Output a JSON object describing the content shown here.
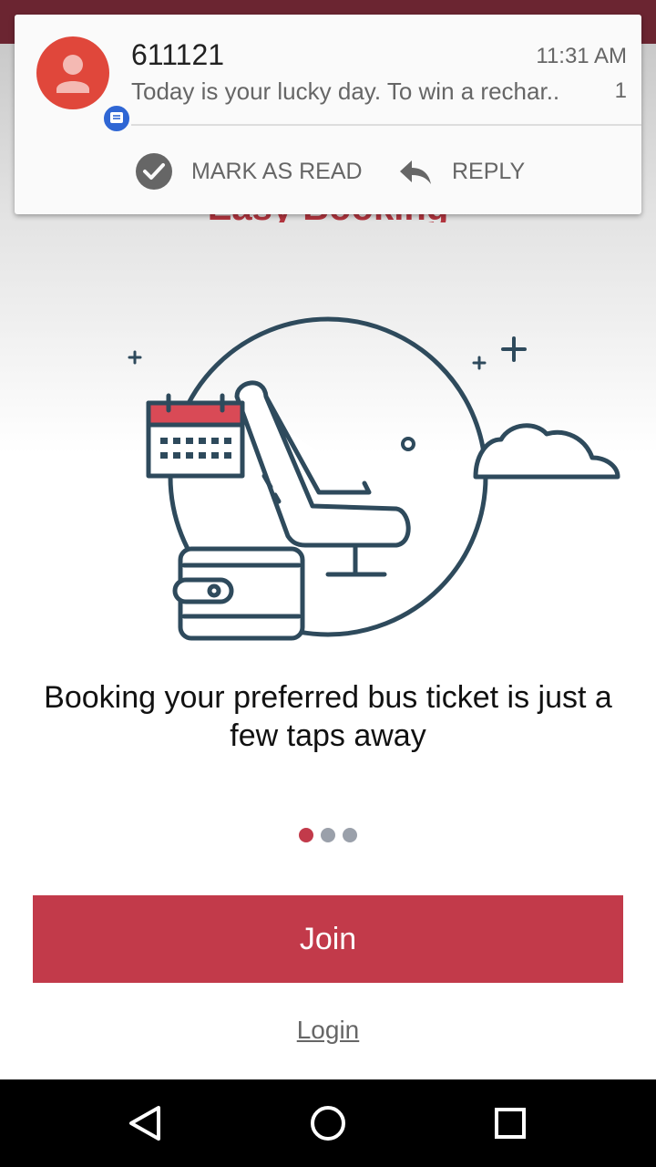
{
  "notification": {
    "sender": "611121",
    "time": "11:31 AM",
    "message": "Today is your lucky day. To win a rechar..",
    "count": "1",
    "actions": {
      "mark_as_read": "MARK AS READ",
      "reply": "REPLY"
    }
  },
  "onboarding": {
    "title": "Easy Booking",
    "tagline": "Booking your preferred bus ticket is just a few taps away",
    "page_indicator": {
      "total": 3,
      "active": 1
    }
  },
  "buttons": {
    "join": "Join",
    "login": "Login"
  },
  "icons": {
    "avatar": "person-icon",
    "badge": "message-icon",
    "mark_read": "check-circle-icon",
    "reply": "reply-icon",
    "nav_back": "back-triangle-icon",
    "nav_home": "home-circle-icon",
    "nav_recents": "recents-square-icon"
  },
  "colors": {
    "accent": "#c23a4a",
    "status_bar": "#6b2531",
    "illustration_stroke": "#2e4a5c",
    "notification_avatar": "#e0473b",
    "notification_badge": "#2f66d4"
  }
}
